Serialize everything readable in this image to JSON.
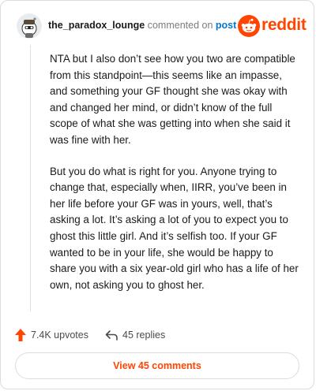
{
  "comment": {
    "username": "the_paradox_lounge",
    "action_text": "commented on",
    "target_link": "post",
    "paragraphs": [
      "NTA but I also don’t see how you two are compatible from this standpoint—this seems like an impasse, and something your GF thought she was okay with and changed her mind, or didn’t know of the full scope of what she was getting into when she said it was fine with her.",
      "But you do what is right for you. Anyone trying to change that, especially when, IIRR, you’ve been in her life before your GF was in yours, well, that’s asking a lot. It’s asking a lot of you to expect you to ghost this little girl. And it’s selfish too. If your GF wanted to be in your life, she would be happy to share you with a six year-old girl who has a life of her own, not asking you to ghost her."
    ]
  },
  "brand": {
    "wordmark": "reddit",
    "color": "#ff4500"
  },
  "actions": {
    "upvotes": "7.4K upvotes",
    "replies": "45 replies"
  },
  "view_comments_label": "View 45 comments",
  "icons": {
    "avatar": "snoo-avatar",
    "brand": "reddit-alien-icon",
    "upvote": "upvote-arrow-icon",
    "reply": "reply-arrow-icon"
  }
}
